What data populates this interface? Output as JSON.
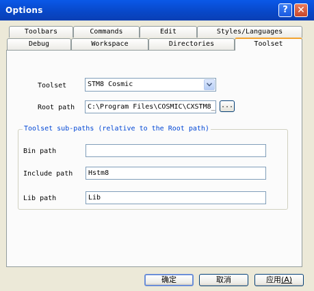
{
  "window": {
    "title": "Options",
    "help_glyph": "?",
    "close_glyph": "✕"
  },
  "tabs_back": [
    "Toolbars",
    "Commands",
    "Edit",
    "Styles/Languages"
  ],
  "tabs_front": [
    "Debug",
    "Workspace",
    "Directories",
    "Toolset"
  ],
  "active_tab": "Toolset",
  "toolset": {
    "toolset_label": "Toolset",
    "toolset_value": "STM8 Cosmic",
    "root_label": "Root path",
    "root_value": "C:\\Program Files\\COSMIC\\CXSTM8_",
    "browse_label": "..."
  },
  "subpaths": {
    "title": "Toolset sub-paths (relative to the Root path)",
    "bin_label": "Bin path",
    "bin_value": "",
    "include_label": "Include path",
    "include_value": "Hstm8",
    "lib_label": "Lib path",
    "lib_value": "Lib"
  },
  "buttons": {
    "ok": "确定",
    "cancel": "取消",
    "apply": "应用",
    "apply_key": "(A)"
  }
}
